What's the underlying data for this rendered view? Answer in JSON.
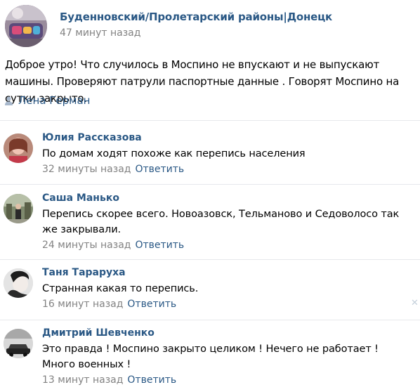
{
  "post": {
    "group_name": "Буденновский/Пролетарский районы|Донецк",
    "time": "47 минут назад",
    "text": "Доброе утро! Что случилось в Моспино не впускают и не выпускают машины. Проверяют патрули паспортные данные . Говорят Моспино на сутки закрыто.",
    "author": "Лена Герман",
    "author_icon": "person-icon"
  },
  "comments": [
    {
      "name": "Юлия Рассказова",
      "text": "По домам ходят похоже как перепись населения",
      "time": "32 минуты назад",
      "reply": "Ответить"
    },
    {
      "name": "Саша Манько",
      "text": "Перепись скорее всего. Новоазовск, Тельманово и Седоволосо так же закрывали.",
      "time": "24 минуты назад",
      "reply": "Ответить"
    },
    {
      "name": "Таня Тарарухa",
      "text": "Странная какая то перепись.",
      "time": "16 минут назад",
      "reply": "Ответить",
      "close": "✕"
    },
    {
      "name": "Дмитрий Шевченко",
      "text": "Это правда ! Моспино закрыто целиком ! Нечего не работает ! Много военных !",
      "time": "13 минут назад",
      "reply": "Ответить"
    }
  ],
  "colors": {
    "link": "#2a5885",
    "muted": "#828282",
    "divider": "#e7e8ec"
  }
}
